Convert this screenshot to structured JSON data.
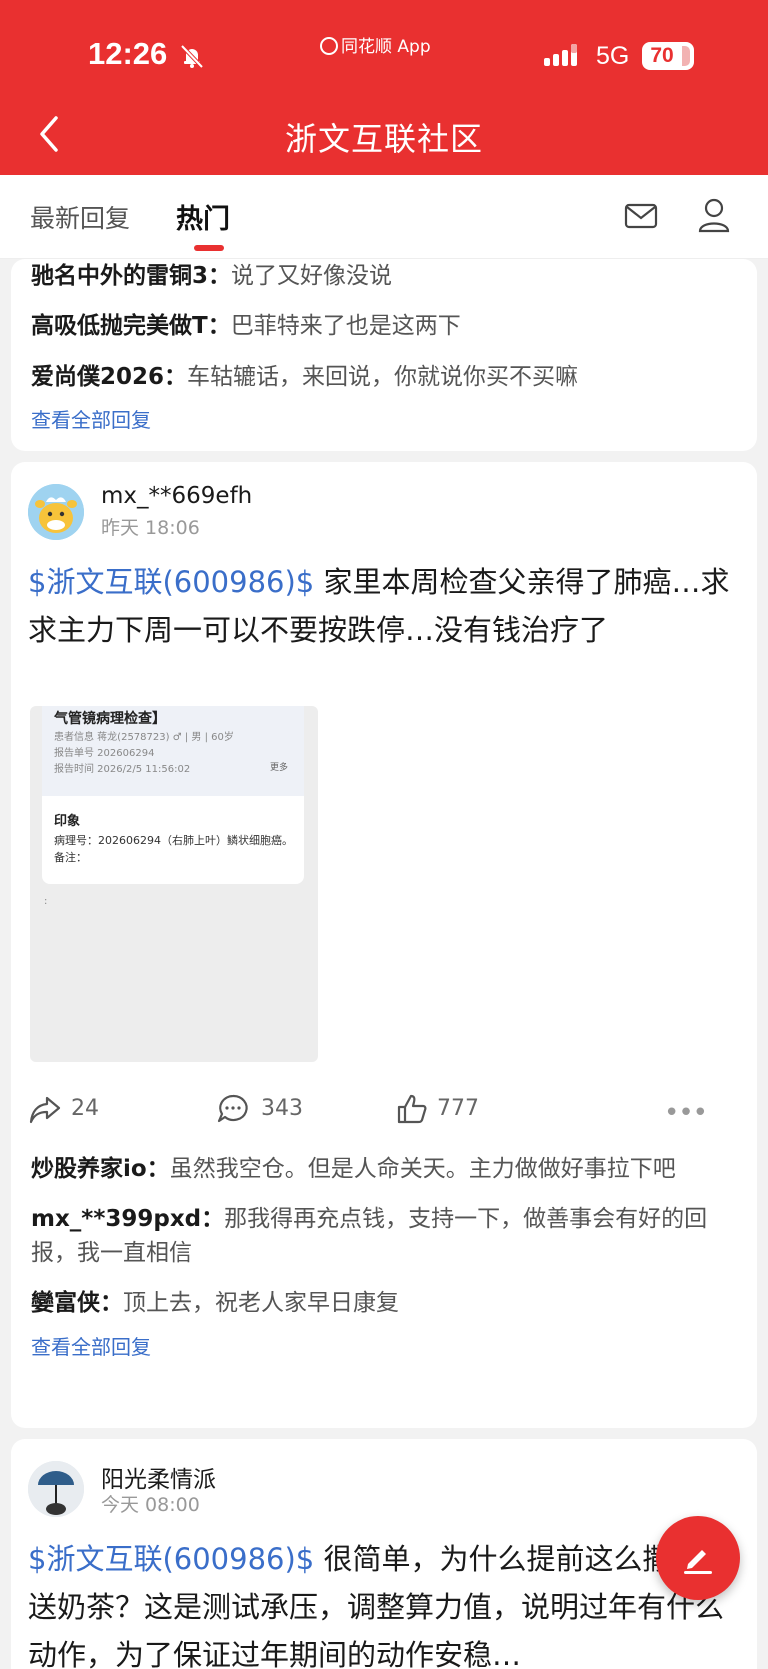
{
  "status": {
    "time": "12:26",
    "app_badge": "同花顺 App",
    "network": "5G",
    "battery": "70"
  },
  "header": {
    "title": "浙文互联社区"
  },
  "tabs": [
    {
      "label": "最新回复"
    },
    {
      "label": "热门"
    }
  ],
  "top_card": {
    "replies": [
      {
        "user": "驰名中外的雷铜3：",
        "text": "说了又好像没说"
      },
      {
        "user": "高吸低抛完美做T：",
        "text": "巴菲特来了也是这两下"
      },
      {
        "user": "爱尚僕2026：",
        "text": "车轱辘话，来回说，你就说你买不买嘛"
      }
    ],
    "view_all": "查看全部回复"
  },
  "post1": {
    "username": "mx_**669efh",
    "time": "昨天 18:06",
    "tag": "$浙文互联(600986)$",
    "text": " 家里本周检查父亲得了肺癌…求求主力下周一可以不要按跌停…没有钱治疗了",
    "image": {
      "title": "气管镜病理检查】",
      "patient": "患者信息  蒋龙(2578723)  ♂ | 男 | 60岁",
      "report_no": "报告单号  202606294",
      "report_time": "报告时间  2026/2/5 11:56:02",
      "more": "更多",
      "impression": "印象",
      "pathology": "病理号：202606294（右肺上叶）鳞状细胞癌。备注：",
      "colon": ":"
    },
    "shares": "24",
    "comments": "343",
    "likes": "777",
    "replies": [
      {
        "user": "炒股养家io：",
        "text": "虽然我空仓。但是人命关天。主力做做好事拉下吧"
      },
      {
        "user": "mx_**399pxd：",
        "text": "那我得再充点钱，支持一下，做善事会有好的回报，我一直相信"
      },
      {
        "user": "孌富侠：",
        "text": "顶上去，祝老人家早日康复"
      }
    ],
    "view_all": "查看全部回复"
  },
  "post2": {
    "username": "阳光柔情派",
    "time": "今天 08:00",
    "tag": "$浙文互联(600986)$",
    "text": " 很简单，为什么提前这么撒红包送奶茶？这是测试承压，调整算力值，说明过年有什么动作，为了保证过年期间的动作安稳…"
  },
  "colors": {
    "brand_red": "#e93030",
    "link_blue": "#3a6ec9"
  }
}
